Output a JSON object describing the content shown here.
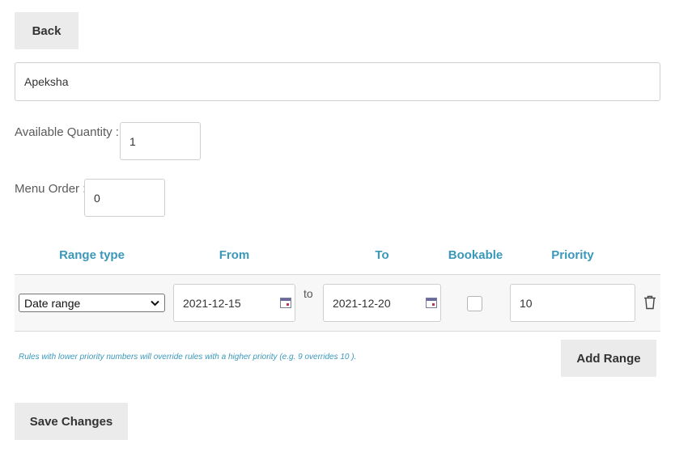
{
  "back_button": "Back",
  "name_field": {
    "value": "Apeksha"
  },
  "available_quantity": {
    "label": "Available Quantity :",
    "value": "1"
  },
  "menu_order": {
    "label": "Menu Order :",
    "value": "0"
  },
  "table": {
    "headers": [
      "Range type",
      "From",
      "To",
      "Bookable",
      "Priority"
    ],
    "rows": [
      {
        "range_type": "Date range",
        "from": "2021-12-15",
        "separator": "to",
        "to": "2021-12-20",
        "bookable": false,
        "priority": "10"
      }
    ]
  },
  "note": "Rules with lower priority numbers will override rules with a higher priority (e.g. 9 overrides 10 ).",
  "add_range_button": "Add Range",
  "save_button": "Save Changes",
  "colors": {
    "accent": "#3a98b9",
    "button_bg": "#ebebeb"
  },
  "icons": [
    "calendar-icon",
    "trash-icon",
    "chevron-down-icon"
  ]
}
